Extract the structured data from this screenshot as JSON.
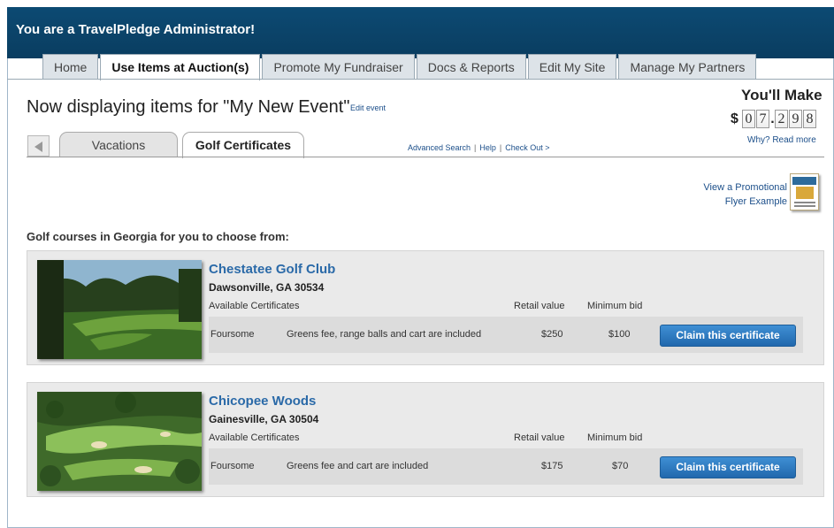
{
  "header": {
    "admin_title": "You are a TravelPledge Administrator!"
  },
  "tabs": [
    {
      "label": "Home"
    },
    {
      "label": "Use Items at Auction(s)",
      "active": true
    },
    {
      "label": "Promote My Fundraiser"
    },
    {
      "label": "Docs & Reports"
    },
    {
      "label": "Edit My Site"
    },
    {
      "label": "Manage My Partners"
    }
  ],
  "event": {
    "title": "Now displaying items for \"My New Event\"",
    "edit_label": "Edit event"
  },
  "earnings": {
    "label": "You'll Make",
    "currency": "$",
    "digits": [
      "0",
      "7",
      ".",
      "2",
      "9",
      "8"
    ],
    "why_label": "Why? Read more"
  },
  "subtabs": [
    {
      "label": "Vacations"
    },
    {
      "label": "Golf Certificates",
      "active": true
    }
  ],
  "search_links": {
    "advanced": "Advanced Search",
    "help": "Help",
    "checkout": "Check Out >"
  },
  "flyer": {
    "line1": "View a Promotional",
    "line2": "Flyer Example"
  },
  "section_heading": "Golf courses in Georgia for you to choose from:",
  "table_headers": {
    "available": "Available Certificates",
    "retail": "Retail value",
    "min_bid": "Minimum bid"
  },
  "courses": [
    {
      "name": "Chestatee Golf Club",
      "location": "Dawsonville, GA 30534",
      "cert_type": "Foursome",
      "description": "Greens fee, range balls and cart are included",
      "retail": "$250",
      "min_bid": "$100",
      "button": "Claim this certificate"
    },
    {
      "name": "Chicopee Woods",
      "location": "Gainesville, GA 30504",
      "cert_type": "Foursome",
      "description": "Greens fee and cart are included",
      "retail": "$175",
      "min_bid": "$70",
      "button": "Claim this certificate"
    }
  ],
  "colors": {
    "topbar": "#0c4a73",
    "link": "#1c4f8a",
    "course_name": "#2b6aa8",
    "button": "#2f7cc2"
  }
}
